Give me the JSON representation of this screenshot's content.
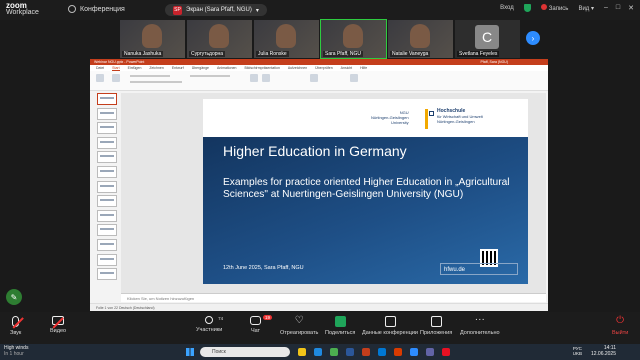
{
  "app": {
    "logo_line1": "zoom",
    "logo_line2": "Workplace",
    "meeting_label": "Конференция"
  },
  "share_indicator": {
    "badge": "SP",
    "label": "Экран (Sara Pfaff, NGU)"
  },
  "top_right": {
    "login": "Вход",
    "record": "Запись",
    "view": "Вид"
  },
  "participants": [
    {
      "name": "Nanuka Jashuka"
    },
    {
      "name": "Сургутьдорна"
    },
    {
      "name": "Julia Ronske"
    },
    {
      "name": "Sara Pfaff, NGU",
      "active": true
    },
    {
      "name": "Natalie Vaneyga"
    },
    {
      "name": "Svetlana Feyeles",
      "letter": "C"
    }
  ],
  "ppt": {
    "title_bar": "Webinar NGU.pptx - PowerPoint",
    "user": "Pfaff, Sara (NGU)",
    "tabs": [
      "Datei",
      "Start",
      "Einfügen",
      "Zeichnen",
      "Entwurf",
      "Übergänge",
      "Animationen",
      "Bildschirmpräsentation",
      "Aufzeichnen",
      "Überprüfen",
      "Ansicht",
      "Hilfe"
    ],
    "active_tab": "Start",
    "notes_placeholder": "Klicken Sie, um Notizen hinzuzufügen",
    "status": "Folie 1 von 22    Deutsch (Deutschland)",
    "slide": {
      "logo_left": [
        "NGU",
        "Nürtingen-Geislingen",
        "University"
      ],
      "logo_right_title": "Hochschule",
      "logo_right_lines": [
        "für Wirtschaft und Umwelt",
        "Nürtingen-Geislingen"
      ],
      "title": "Higher Education in Germany",
      "subtitle": "Examples for practice oriented Higher Education in „Agricultural Sciences\" at Nuertingen-Geislingen University (NGU)",
      "footer_date": "12th June 2025, Sara Pfaff, NGU",
      "url": "hfwu.de"
    }
  },
  "controls": [
    {
      "name": "audio",
      "label": "Звук"
    },
    {
      "name": "video",
      "label": "Видео"
    },
    {
      "name": "participants",
      "label": "Участники",
      "count": "74"
    },
    {
      "name": "chat",
      "label": "Чат",
      "badge": "19"
    },
    {
      "name": "react",
      "label": "Отреагировать"
    },
    {
      "name": "share",
      "label": "Поделиться"
    },
    {
      "name": "summary",
      "label": "Данные конференции"
    },
    {
      "name": "apps",
      "label": "Приложения"
    },
    {
      "name": "more",
      "label": "Дополнительно"
    },
    {
      "name": "leave",
      "label": "Выйти"
    }
  ],
  "taskbar": {
    "weather_title": "High winds",
    "weather_sub": "In 1 hour",
    "search_placeholder": "Поиск",
    "lang_top": "РУС",
    "lang_bottom": "UKB",
    "time": "14:11",
    "date": "12.06.2025"
  },
  "colors": {
    "ppt_accent": "#c43e1c",
    "slide_blue": "#1e4f86",
    "zoom_active": "#2ecc40",
    "share_green": "#1fa55a",
    "leave_red": "#e33333"
  }
}
